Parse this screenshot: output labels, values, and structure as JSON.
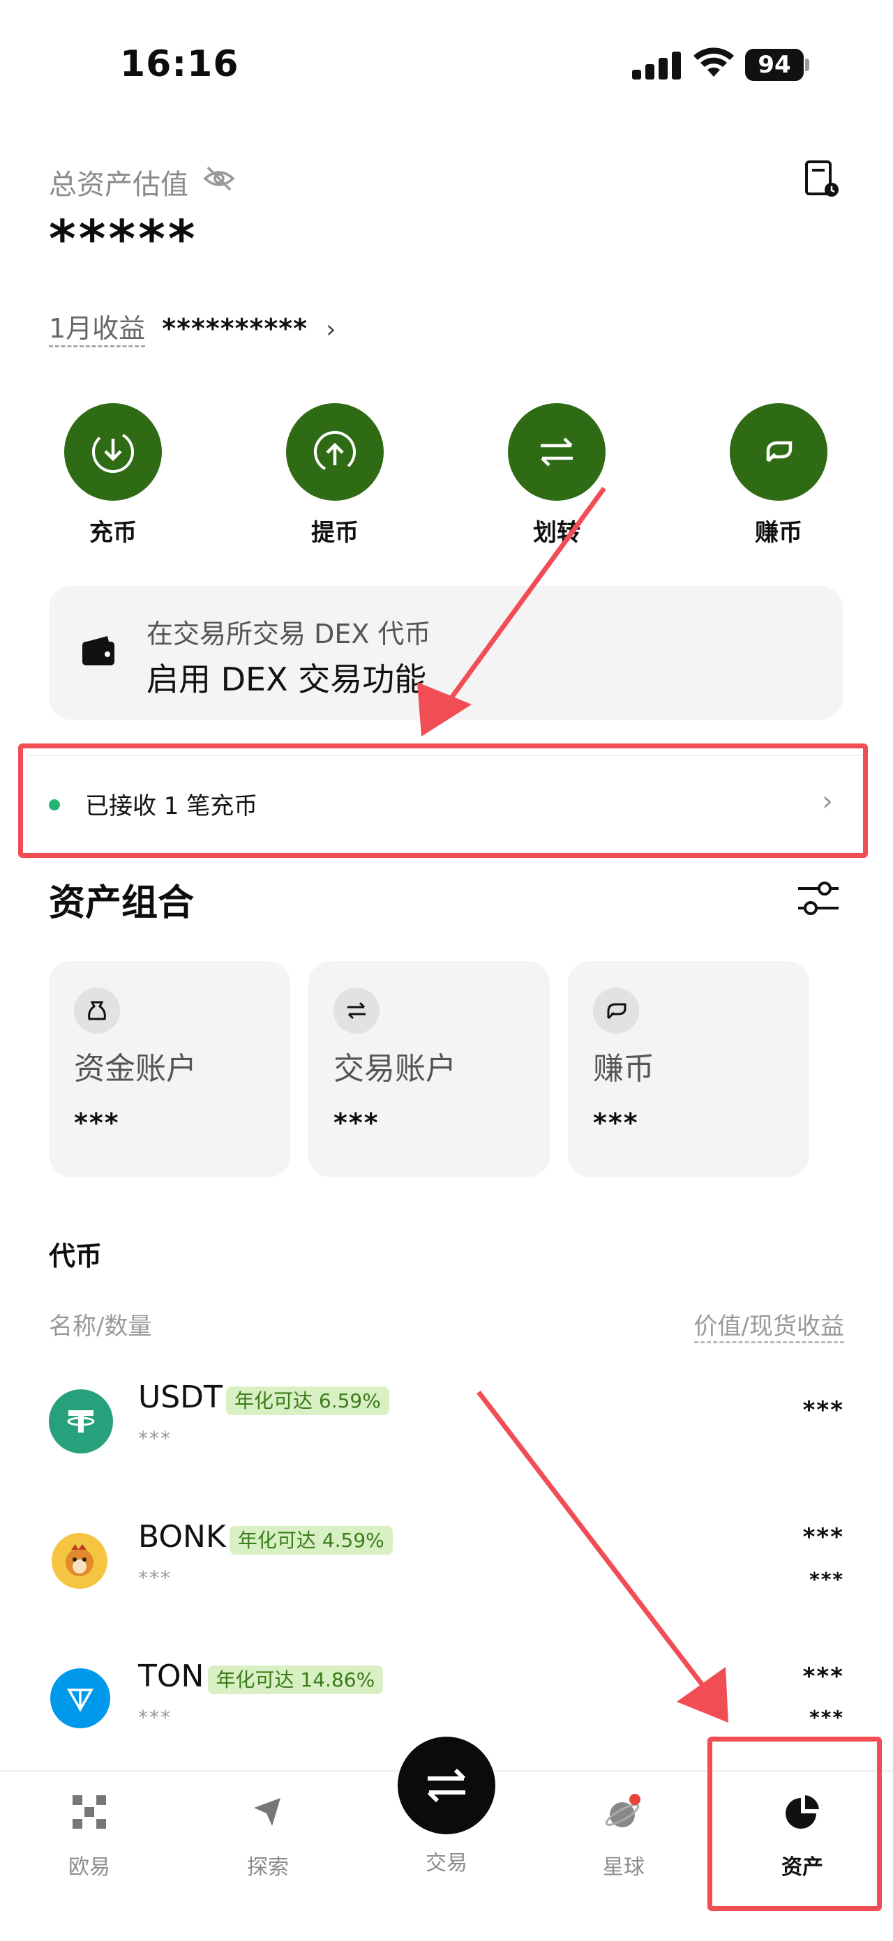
{
  "status_bar": {
    "time": "16:16",
    "battery": "94"
  },
  "header": {
    "total_label": "总资产估值",
    "total_value": "*****",
    "month_label": "1月收益",
    "month_value": "**********"
  },
  "actions": [
    {
      "label": "充币",
      "icon": "deposit-icon"
    },
    {
      "label": "提币",
      "icon": "withdraw-icon"
    },
    {
      "label": "划转",
      "icon": "transfer-icon"
    },
    {
      "label": "赚币",
      "icon": "earn-icon"
    }
  ],
  "dex_card": {
    "subtitle": "在交易所交易 DEX 代币",
    "title": "启用 DEX 交易功能"
  },
  "notice": {
    "text": "已接收 1 笔充币"
  },
  "portfolio": {
    "title": "资产组合",
    "accounts": [
      {
        "name": "资金账户",
        "value": "***",
        "icon": "bag-icon"
      },
      {
        "name": "交易账户",
        "value": "***",
        "icon": "swap-icon"
      },
      {
        "name": "赚币",
        "value": "***",
        "icon": "earn-icon"
      }
    ]
  },
  "tokens": {
    "title": "代币",
    "col_left": "名称/数量",
    "col_right": "价值/现货收益",
    "items": [
      {
        "symbol": "USDT",
        "badge": "年化可达 6.59%",
        "amount": "***",
        "value": "***",
        "pnl": "",
        "logo_color": "#26a17b"
      },
      {
        "symbol": "BONK",
        "badge": "年化可达 4.59%",
        "amount": "***",
        "value": "***",
        "pnl": "***",
        "logo_color": "#f5c542"
      },
      {
        "symbol": "TON",
        "badge": "年化可达 14.86%",
        "amount": "***",
        "value": "***",
        "pnl": "***",
        "logo_color": "#0098ea"
      }
    ]
  },
  "tabbar": {
    "tabs": [
      {
        "label": "欧易",
        "icon": "okx-logo-icon"
      },
      {
        "label": "探索",
        "icon": "compass-icon"
      },
      {
        "label": "交易",
        "icon": "trade-swap-icon"
      },
      {
        "label": "星球",
        "icon": "planet-icon"
      },
      {
        "label": "资产",
        "icon": "pie-chart-icon"
      }
    ]
  },
  "colors": {
    "accent_green": "#2e6b14",
    "annotation_red": "#f14d55",
    "badge_green": "#3a7d1a"
  }
}
